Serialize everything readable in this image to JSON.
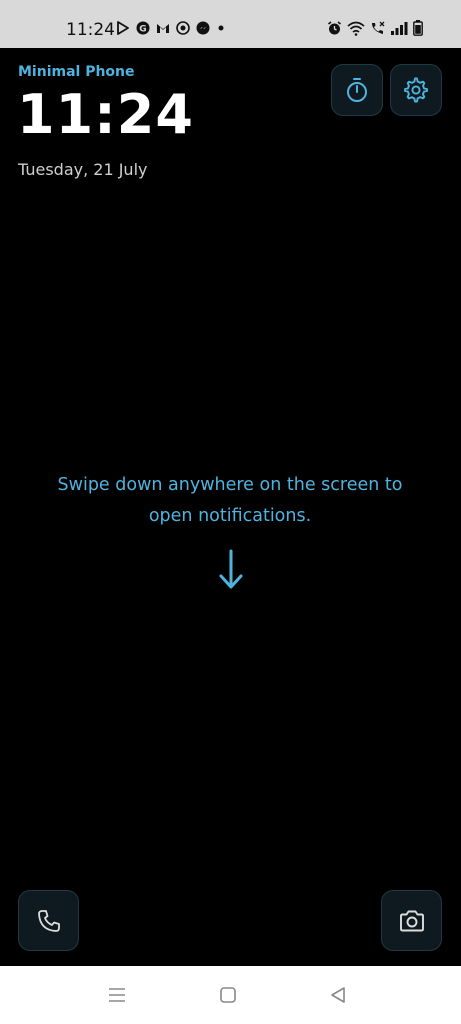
{
  "status_bar": {
    "time": "11:24",
    "left_icons": [
      "play-store-icon",
      "google-icon",
      "gmail-icon",
      "chat-icon",
      "messenger-icon",
      "dot-icon"
    ],
    "right_icons": [
      "alarm-icon",
      "wifi-icon",
      "call-icon",
      "signal-icon",
      "battery-icon"
    ]
  },
  "header": {
    "app_name": "Minimal Phone",
    "clock": "11:24",
    "date": "Tuesday, 21 July"
  },
  "buttons": {
    "timer_icon": "timer-icon",
    "settings_icon": "gear-icon",
    "phone_icon": "phone-icon",
    "camera_icon": "camera-icon"
  },
  "hint": {
    "line1": "Swipe down anywhere on the screen to",
    "line2": "open notifications."
  },
  "colors": {
    "accent": "#4fb3e0",
    "background": "#000000",
    "button_bg": "#0e1a1f"
  },
  "nav": {
    "icons": [
      "menu-icon",
      "home-icon",
      "back-icon"
    ]
  }
}
